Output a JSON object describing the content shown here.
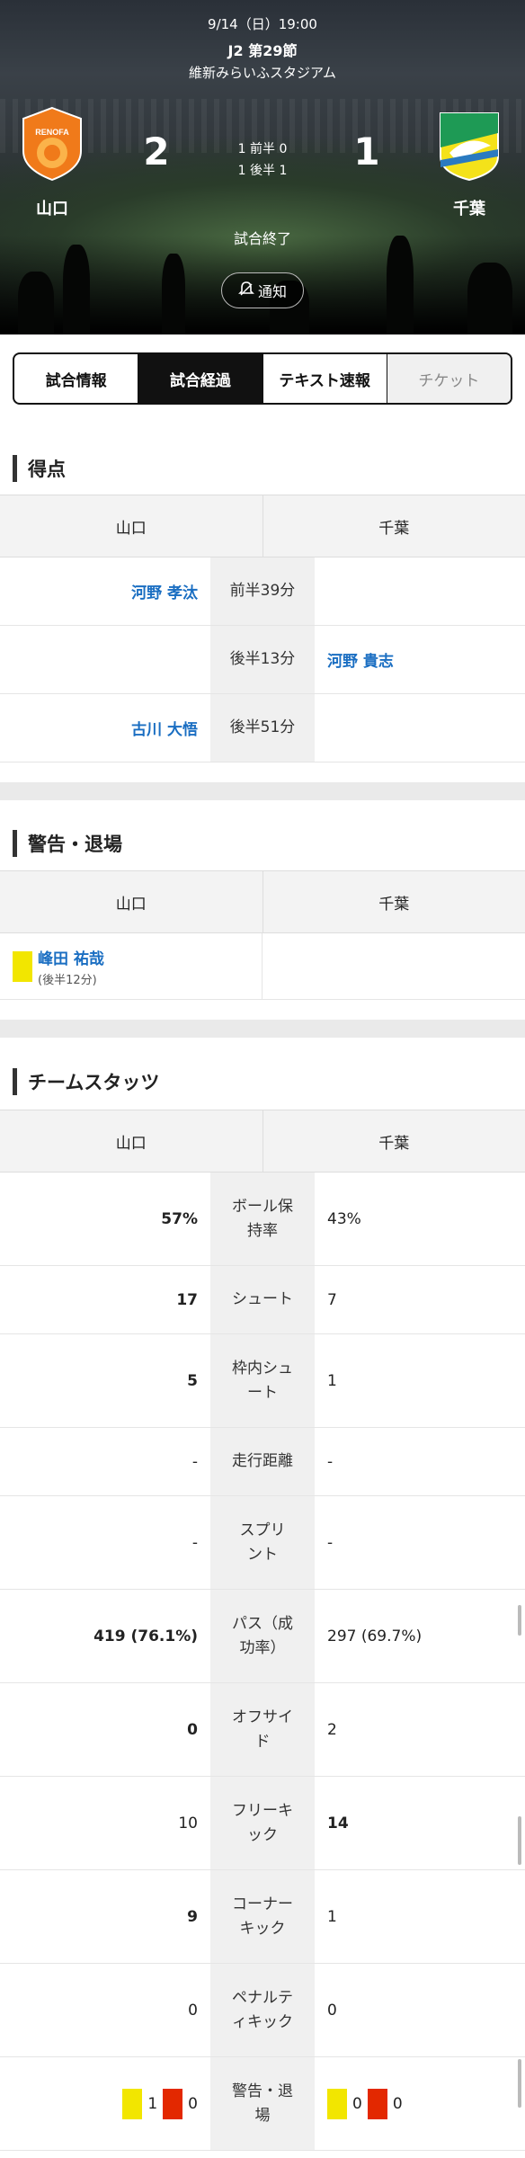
{
  "match": {
    "date": "9/14（日）19:00",
    "round": "J2 第29節",
    "venue": "維新みらいふスタジアム",
    "home": {
      "name": "山口",
      "score": "2",
      "logo_text": "RENOFA"
    },
    "away": {
      "name": "千葉",
      "score": "1"
    },
    "first_half": "1 前半 0",
    "second_half": "1 後半 1",
    "status": "試合終了",
    "notify_label": "通知"
  },
  "tabs": [
    {
      "label": "試合情報",
      "state": "normal"
    },
    {
      "label": "試合経過",
      "state": "active"
    },
    {
      "label": "テキスト速報",
      "state": "normal"
    },
    {
      "label": "チケット",
      "state": "disabled"
    }
  ],
  "goals": {
    "title": "得点",
    "home": "山口",
    "away": "千葉",
    "rows": [
      {
        "home": "河野 孝汰",
        "time": "前半39分",
        "away": ""
      },
      {
        "home": "",
        "time": "後半13分",
        "away": "河野 貴志"
      },
      {
        "home": "古川 大悟",
        "time": "後半51分",
        "away": ""
      }
    ]
  },
  "cards": {
    "title": "警告・退場",
    "home": "山口",
    "away": "千葉",
    "rows": [
      {
        "home_player": "峰田 祐哉",
        "home_time": "(後半12分)",
        "card": "yellow"
      }
    ]
  },
  "stats": {
    "title": "チームスタッツ",
    "home": "山口",
    "away": "千葉",
    "rows": [
      {
        "home": "57%",
        "label": "ボール保持率",
        "away": "43%",
        "emph": "home"
      },
      {
        "home": "17",
        "label": "シュート",
        "away": "7",
        "emph": "home"
      },
      {
        "home": "5",
        "label": "枠内シュート",
        "away": "1",
        "emph": "home"
      },
      {
        "home": "-",
        "label": "走行距離",
        "away": "-",
        "emph": "none"
      },
      {
        "home": "-",
        "label": "スプリント",
        "away": "-",
        "emph": "none"
      },
      {
        "home": "419 (76.1%)",
        "label": "パス（成功率）",
        "away": "297 (69.7%)",
        "emph": "home"
      },
      {
        "home": "0",
        "label": "オフサイド",
        "away": "2",
        "emph": "home"
      },
      {
        "home": "10",
        "label": "フリーキック",
        "away": "14",
        "emph": "away"
      },
      {
        "home": "9",
        "label": "コーナーキック",
        "away": "1",
        "emph": "home"
      },
      {
        "home": "0",
        "label": "ペナルティキック",
        "away": "0",
        "emph": "none"
      }
    ],
    "cards_row": {
      "label": "警告・退場",
      "home_yellow": "1",
      "home_red": "0",
      "away_yellow": "0",
      "away_red": "0"
    }
  },
  "colors": {
    "link": "#1a6ec2",
    "yellow_card": "#f2e600",
    "red_card": "#e32800",
    "tab_active": "#111111"
  }
}
